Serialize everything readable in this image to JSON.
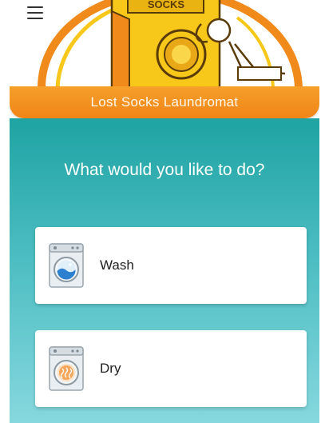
{
  "header": {
    "title": "Lost Socks Laundromat",
    "hero_logo_text": "SOCKS"
  },
  "main": {
    "question": "What would you like to do?",
    "options": [
      {
        "label": "Wash",
        "icon": "washing-machine-icon"
      },
      {
        "label": "Dry",
        "icon": "dryer-icon"
      }
    ]
  },
  "colors": {
    "banner_orange": "#f08417",
    "teal_top": "#1fa3a3",
    "teal_bottom": "#86d8de",
    "logo_yellow": "#f7c719",
    "logo_orange": "#f08a1a"
  }
}
